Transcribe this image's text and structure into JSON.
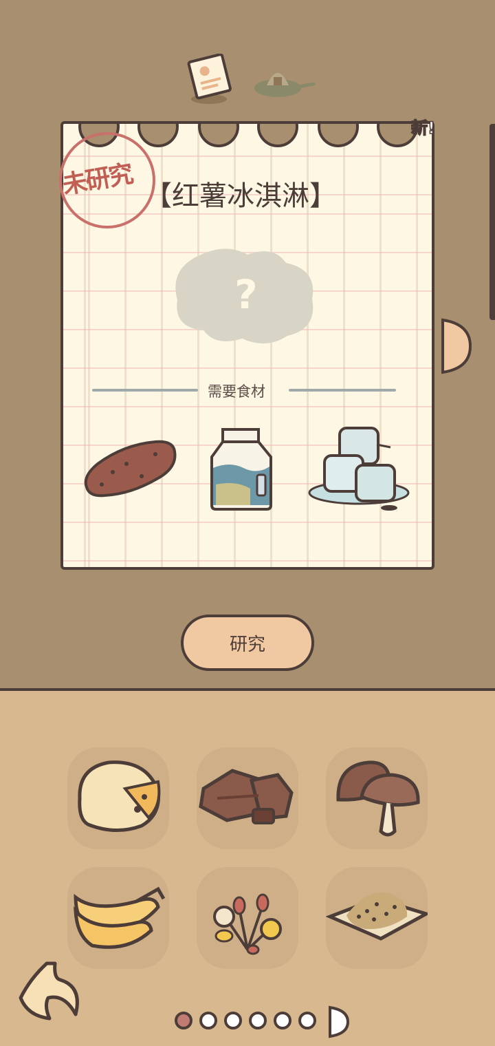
{
  "recipe": {
    "badge_new": "新!",
    "status_stamp": "未研究",
    "title": "【红薯冰淇淋】",
    "mystery_symbol": "?",
    "needs_label": "需要食材",
    "ingredients": [
      "sweet-potato-icon",
      "milk-carton-icon",
      "ice-cubes-icon"
    ]
  },
  "actions": {
    "research_label": "研究"
  },
  "ingredient_grid": [
    {
      "name": "cheese-icon"
    },
    {
      "name": "chocolate-icon"
    },
    {
      "name": "mushroom-icon"
    },
    {
      "name": "banana-icon"
    },
    {
      "name": "flowers-icon"
    },
    {
      "name": "grain-icon"
    }
  ],
  "pagination": {
    "pages": 6,
    "current": 1
  },
  "colors": {
    "background": "#a88f6f",
    "panel": "#d8b88e",
    "outline": "#4d3d38",
    "stamp": "#c25f55",
    "button": "#f0c9a2"
  }
}
